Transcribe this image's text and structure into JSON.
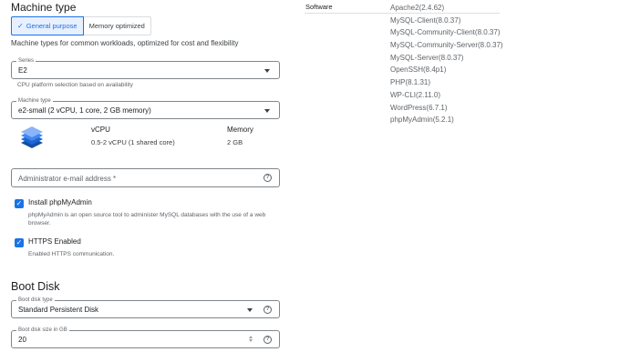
{
  "machine_type": {
    "title": "Machine type",
    "purpose_tabs": [
      {
        "label": "General purpose",
        "selected": true
      },
      {
        "label": "Memory optimized",
        "selected": false
      }
    ],
    "description": "Machine types for common workloads, optimized for cost and flexibility"
  },
  "series": {
    "label": "Series",
    "value": "E2",
    "hint": "CPU platform selection based on availability"
  },
  "machine": {
    "label": "Machine type",
    "value": "e2-small (2 vCPU, 1 core, 2 GB memory)",
    "vcpu_header": "vCPU",
    "vcpu_value": "0.5-2 vCPU (1 shared core)",
    "memory_header": "Memory",
    "memory_value": "2 GB",
    "icon": "layers-stack-icon",
    "icon_color": "#1a73e8"
  },
  "admin_email": {
    "placeholder": "Administrator e-mail address *",
    "value": ""
  },
  "options": [
    {
      "label": "Install phpMyAdmin",
      "checked": true,
      "hint": "phpMyAdmin is an open source tool to administer MySQL databases with the use of a web browser."
    },
    {
      "label": "HTTPS Enabled",
      "checked": true,
      "hint": "Enabled HTTPS communication."
    }
  ],
  "boot_disk": {
    "title": "Boot Disk",
    "type_label": "Boot disk type",
    "type_value": "Standard Persistent Disk",
    "size_label": "Boot disk size in GB",
    "size_value": "20"
  },
  "software": {
    "label": "Software",
    "items": [
      "Apache2(2.4.62)",
      "MySQL-Client(8.0.37)",
      "MySQL-Community-Client(8.0.37)",
      "MySQL-Community-Server(8.0.37)",
      "MySQL-Server(8.0.37)",
      "OpenSSH(8.4p1)",
      "PHP(8.1.31)",
      "WP-CLI(2.11.0)",
      "WordPress(6.7.1)",
      "phpMyAdmin(5.2.1)"
    ]
  },
  "colors": {
    "accent": "#1a73e8",
    "selected_bg": "#e8f0fe"
  }
}
